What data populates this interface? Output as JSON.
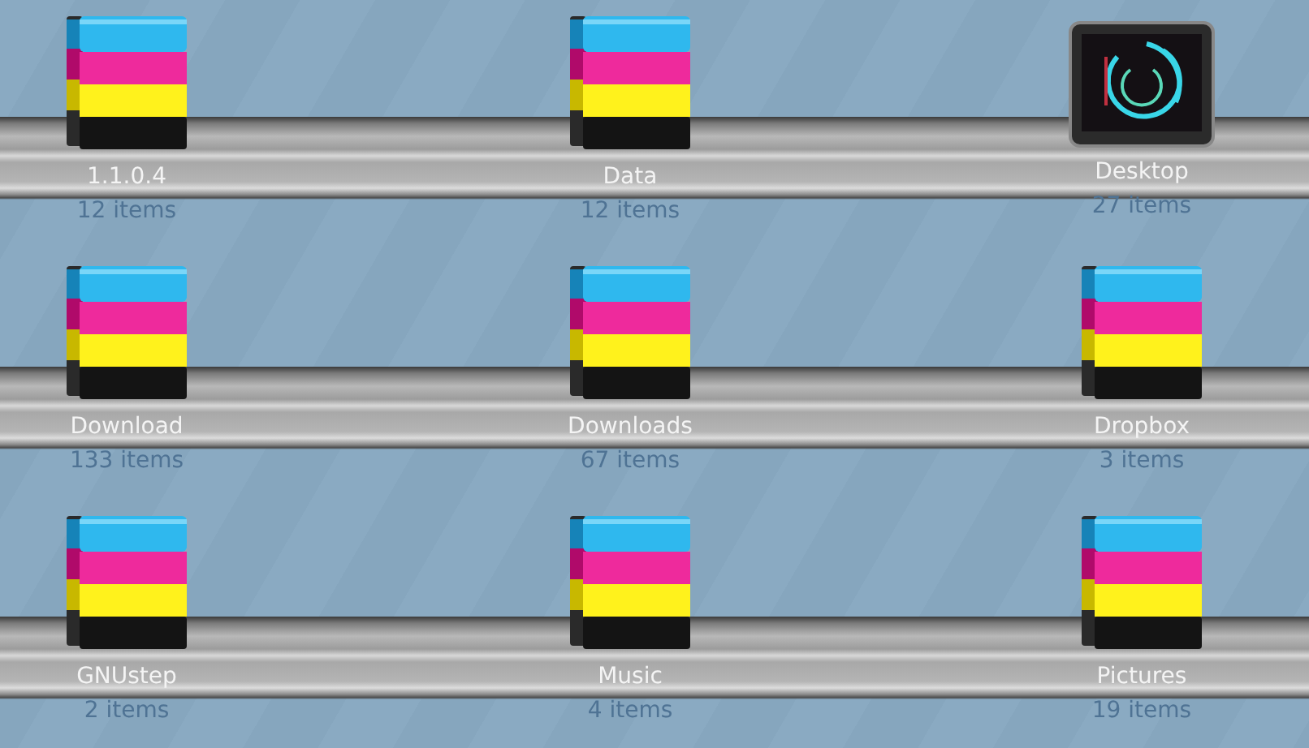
{
  "items": [
    {
      "name": "1.1.0.4",
      "count": "12 items",
      "kind": "folder"
    },
    {
      "name": "Data",
      "count": "12 items",
      "kind": "folder"
    },
    {
      "name": "Desktop",
      "count": "27 items",
      "kind": "desktop"
    },
    {
      "name": "Download",
      "count": "133 items",
      "kind": "folder"
    },
    {
      "name": "Downloads",
      "count": "67 items",
      "kind": "folder"
    },
    {
      "name": "Dropbox",
      "count": "3 items",
      "kind": "folder"
    },
    {
      "name": "GNUstep",
      "count": "2 items",
      "kind": "folder"
    },
    {
      "name": "Music",
      "count": "4 items",
      "kind": "folder"
    },
    {
      "name": "Pictures",
      "count": "19 items",
      "kind": "folder"
    }
  ]
}
